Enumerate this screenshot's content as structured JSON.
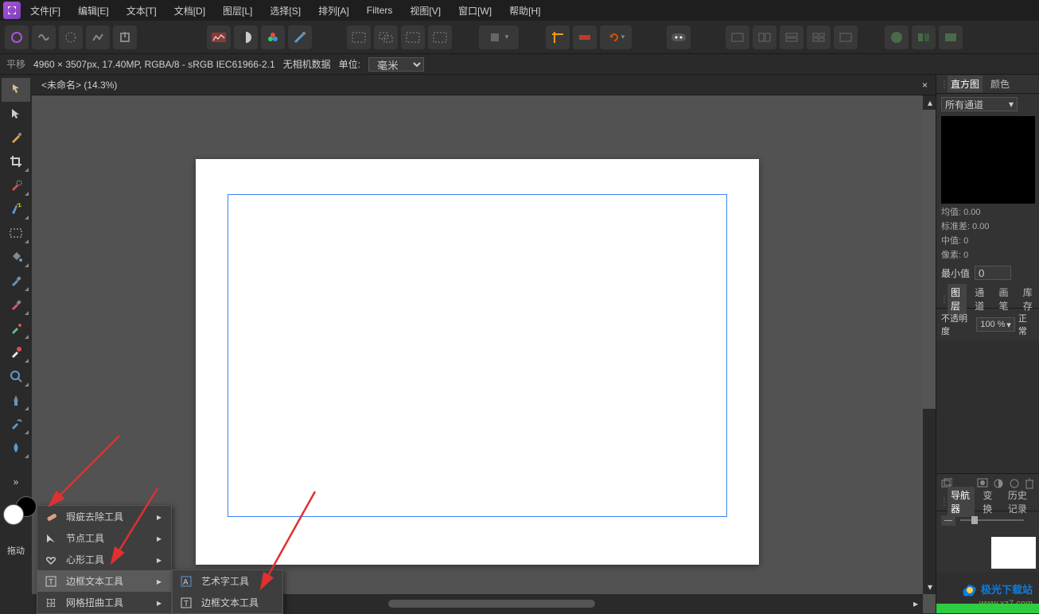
{
  "menubar": {
    "items": [
      "文件[F]",
      "编辑[E]",
      "文本[T]",
      "文档[D]",
      "图层[L]",
      "选择[S]",
      "排列[A]",
      "Filters",
      "视图[V]",
      "窗口[W]",
      "帮助[H]"
    ]
  },
  "contextbar": {
    "tool_name": "平移",
    "doc_info": "4960 × 3507px, 17.40MP, RGBA/8 - sRGB IEC61966-2.1",
    "camera_data": "无相机数据",
    "unit_label": "单位:",
    "unit_value": "毫米"
  },
  "document": {
    "tab_title": "<未命名> (14.3%)",
    "tab_close": "×"
  },
  "flyout1": {
    "items": [
      {
        "label": "瑕疵去除工具",
        "icon": "bandage-icon"
      },
      {
        "label": "节点工具",
        "icon": "node-icon"
      },
      {
        "label": "心形工具",
        "icon": "heart-icon"
      },
      {
        "label": "边框文本工具",
        "icon": "frame-text-icon"
      },
      {
        "label": "网格扭曲工具",
        "icon": "mesh-icon"
      }
    ]
  },
  "flyout2": {
    "items": [
      {
        "label": "艺术字工具",
        "icon": "artistic-text-icon"
      },
      {
        "label": "边框文本工具",
        "icon": "frame-text-icon"
      }
    ]
  },
  "toolbox": {
    "drag_hint": "拖动"
  },
  "panels": {
    "histogram": {
      "tabs": [
        "直方图",
        "颜色"
      ],
      "channel_dropdown": "所有通道",
      "stat_mean": "均值: 0.00",
      "stat_std": "标准差: 0.00",
      "stat_median": "中值: 0",
      "stat_pixels": "像素: 0",
      "min_label": "最小值",
      "min_value": "0"
    },
    "layers": {
      "tabs": [
        "图层",
        "通道",
        "画笔",
        "库存"
      ],
      "opacity_label": "不透明度",
      "opacity_value": "100 %",
      "normal_label": "正常"
    },
    "navigator": {
      "tabs": [
        "导航器",
        "变换",
        "历史记录"
      ]
    }
  },
  "watermark": {
    "brand": "极光下载站",
    "url": "www.xz7.com"
  }
}
